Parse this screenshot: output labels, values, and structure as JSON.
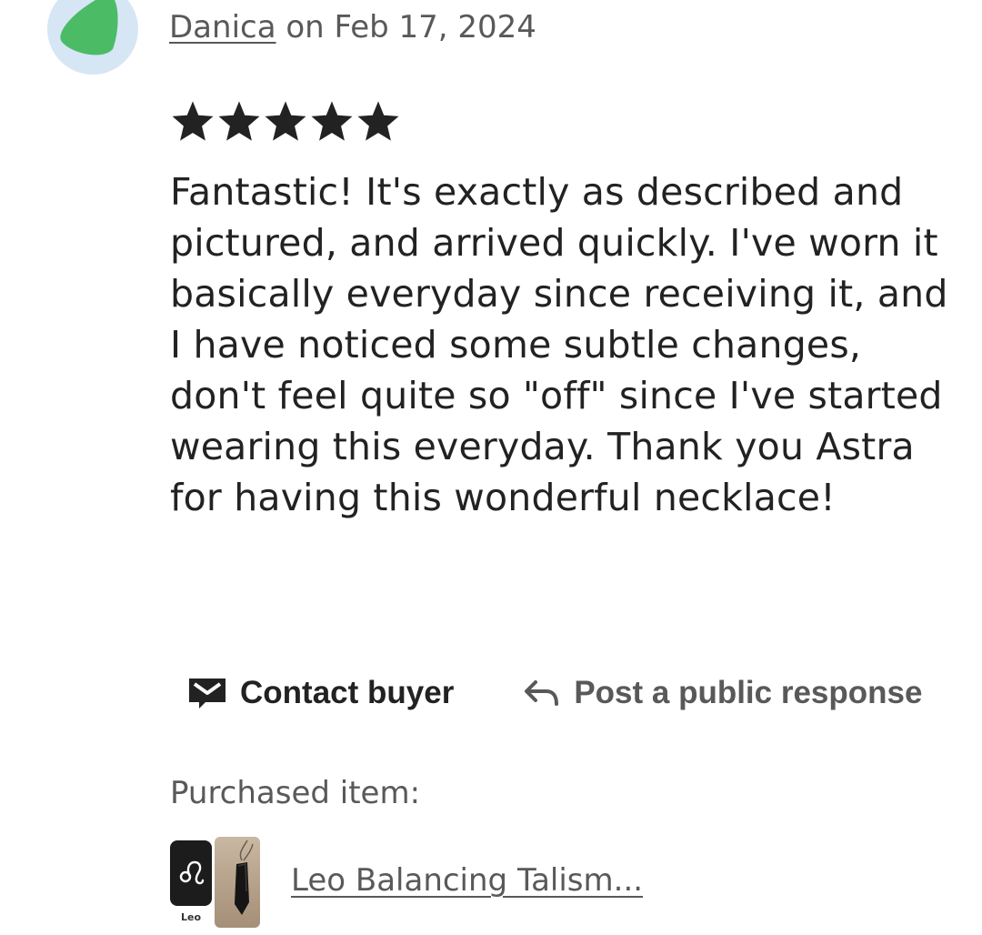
{
  "review": {
    "author": "Danica",
    "date_prefix": "on",
    "date": "Feb 17, 2024",
    "rating": 5,
    "rating_max": 5,
    "text": "Fantastic! It's exactly as described and pictured, and arrived quickly. I've worn it basically everyday since receiving it, and I have noticed some subtle changes, don't feel quite so \"off\" since I've started wearing this everyday. Thank you Astra for having this wonderful necklace!"
  },
  "actions": {
    "contact_label": "Contact buyer",
    "respond_label": "Post a public response"
  },
  "purchased": {
    "label": "Purchased item:",
    "thumb_caption": "Leo",
    "item_title": "Leo Balancing Talism..."
  },
  "colors": {
    "avatar_bg": "#d6e6f5",
    "avatar_shape": "#4cbb66",
    "star": "#222222",
    "text_primary": "#222222",
    "text_secondary": "#595959"
  },
  "icons": {
    "stars": "star-icon",
    "contact": "envelope-icon",
    "respond": "reply-arrow-icon",
    "zodiac": "leo-symbol-icon"
  }
}
